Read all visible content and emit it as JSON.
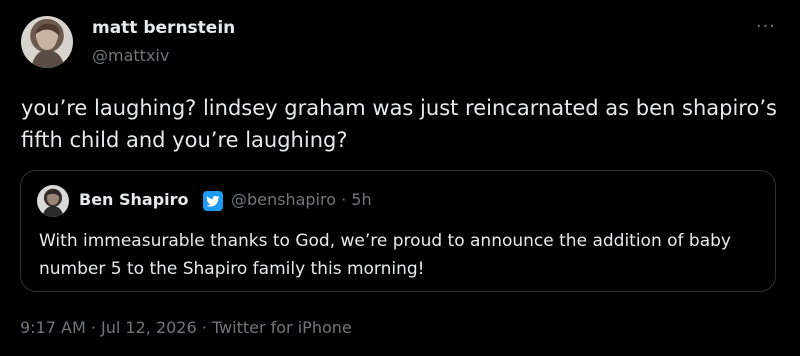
{
  "tweet": {
    "author": {
      "name": "matt bernstein",
      "handle": "@mattxiv"
    },
    "more_label": "···",
    "text": "you’re laughing? lindsey graham was just reincarnated as ben shapiro’s fifth child and you’re laughing?",
    "quote": {
      "author": {
        "name": "Ben Shapiro",
        "handle": "@benshapiro · 5h"
      },
      "text": "With immeasurable thanks to God, we’re proud to announce the addition of baby number 5 to the Shapiro family this morning!"
    },
    "footer": {
      "time": "9:17 AM · Jul 12, 2026 · Twitter for iPhone"
    }
  },
  "colors": {
    "background": "#000000",
    "text_primary": "#e7e9ea",
    "text_secondary": "#71767b",
    "verified_blue": "#1d9bf0",
    "border": "#2f3336"
  }
}
